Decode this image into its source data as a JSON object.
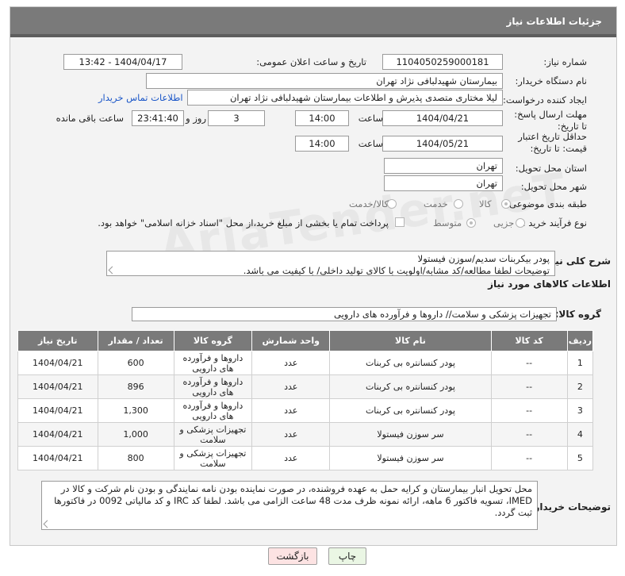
{
  "header": {
    "title": "جزئیات اطلاعات نیاز"
  },
  "fields": {
    "need_number_label": "شماره نیاز:",
    "need_number": "1104050259000181",
    "announce_label": "تاریخ و ساعت اعلان عمومی:",
    "announce_value": "1404/04/17 - 13:42",
    "buyer_org_label": "نام دستگاه خریدار:",
    "buyer_org": "بیمارستان شهیدلبافی نژاد تهران",
    "creator_label": "ایجاد کننده درخواست:",
    "creator": "لیلا مختاری متصدی پذیرش و اطلاعات بیمارستان شهیدلبافی نژاد تهران",
    "contact_link": "اطلاعات تماس خریدار",
    "reply_deadline_label": "مهلت ارسال پاسخ: تا تاریخ:",
    "reply_date": "1404/04/21",
    "time_label": "ساعت",
    "reply_time": "14:00",
    "days": "3",
    "days_label": "روز و",
    "remaining_time": "23:41:40",
    "remaining_label": "ساعت باقی مانده",
    "price_validity_label": "حداقل تاریخ اعتبار قیمت: تا تاریخ:",
    "validity_date": "1404/05/21",
    "validity_time": "14:00",
    "province_label": "استان محل تحویل:",
    "province": "تهران",
    "city_label": "شهر محل تحویل:",
    "city": "تهران",
    "category_label": "طبقه بندی موضوعی:",
    "category_options": [
      "کالا",
      "خدمت",
      "کالا/خدمت"
    ],
    "process_label": "نوع فرآیند خرید :",
    "process_options": [
      "جزیی",
      "متوسط"
    ],
    "payment_note": "پرداخت تمام یا بخشی از مبلغ خرید،از محل \"اسناد خزانه اسلامی\" خواهد بود."
  },
  "description": {
    "label": "شرح کلی نیاز:",
    "text_line1": "پودر بیکربنات سدیم/سوزن فیستولا",
    "text_line2": "توضیحات لطفا مطالعه/کد مشابه/اولویت با کالای تولید داخلی/ با کیفیت می باشد."
  },
  "goods": {
    "section_title": "اطلاعات کالاهای مورد نیاز",
    "group_label": "گروه کالا:",
    "group_value": "تجهیزات پزشکی و سلامت// داروها و فرآورده های دارویی",
    "columns": [
      "ردیف",
      "کد کالا",
      "نام کالا",
      "واحد شمارش",
      "گروه کالا",
      "تعداد / مقدار",
      "تاریخ نیاز"
    ],
    "rows": [
      {
        "idx": "1",
        "code": "--",
        "name": "پودر کنسانتره بی کربنات",
        "unit": "عدد",
        "group": "داروها و فرآورده های دارویی",
        "qty": "600",
        "date": "1404/04/21"
      },
      {
        "idx": "2",
        "code": "--",
        "name": "پودر کنسانتره بی کربنات",
        "unit": "عدد",
        "group": "داروها و فرآورده های دارویی",
        "qty": "896",
        "date": "1404/04/21"
      },
      {
        "idx": "3",
        "code": "--",
        "name": "پودر کنسانتره بی کربنات",
        "unit": "عدد",
        "group": "داروها و فرآورده های دارویی",
        "qty": "1,300",
        "date": "1404/04/21"
      },
      {
        "idx": "4",
        "code": "--",
        "name": "سر سوزن فیستولا",
        "unit": "عدد",
        "group": "تجهیزات پزشکی و سلامت",
        "qty": "1,000",
        "date": "1404/04/21"
      },
      {
        "idx": "5",
        "code": "--",
        "name": "سر سوزن فیستولا",
        "unit": "عدد",
        "group": "تجهیزات پزشکی و سلامت",
        "qty": "800",
        "date": "1404/04/21"
      }
    ]
  },
  "buyer_notes": {
    "label": "توضیحات خریدار:",
    "text": "محل تحویل انبار بیمارستان و کرایه حمل به عهده فروشنده، در صورت نماینده بودن نامه نمایندگی و بودن نام شرکت و کالا در IMED، تسویه فاکتور 6 ماهه، ارائه نمونه ظرف مدت 48 ساعت الزامی می باشد. لطفا کد IRC و کد مالیاتی 0092 در فاکتورها ثبت گردد."
  },
  "buttons": {
    "print": "چاپ",
    "back": "بازگشت"
  },
  "watermark": "AriaTender.neT"
}
